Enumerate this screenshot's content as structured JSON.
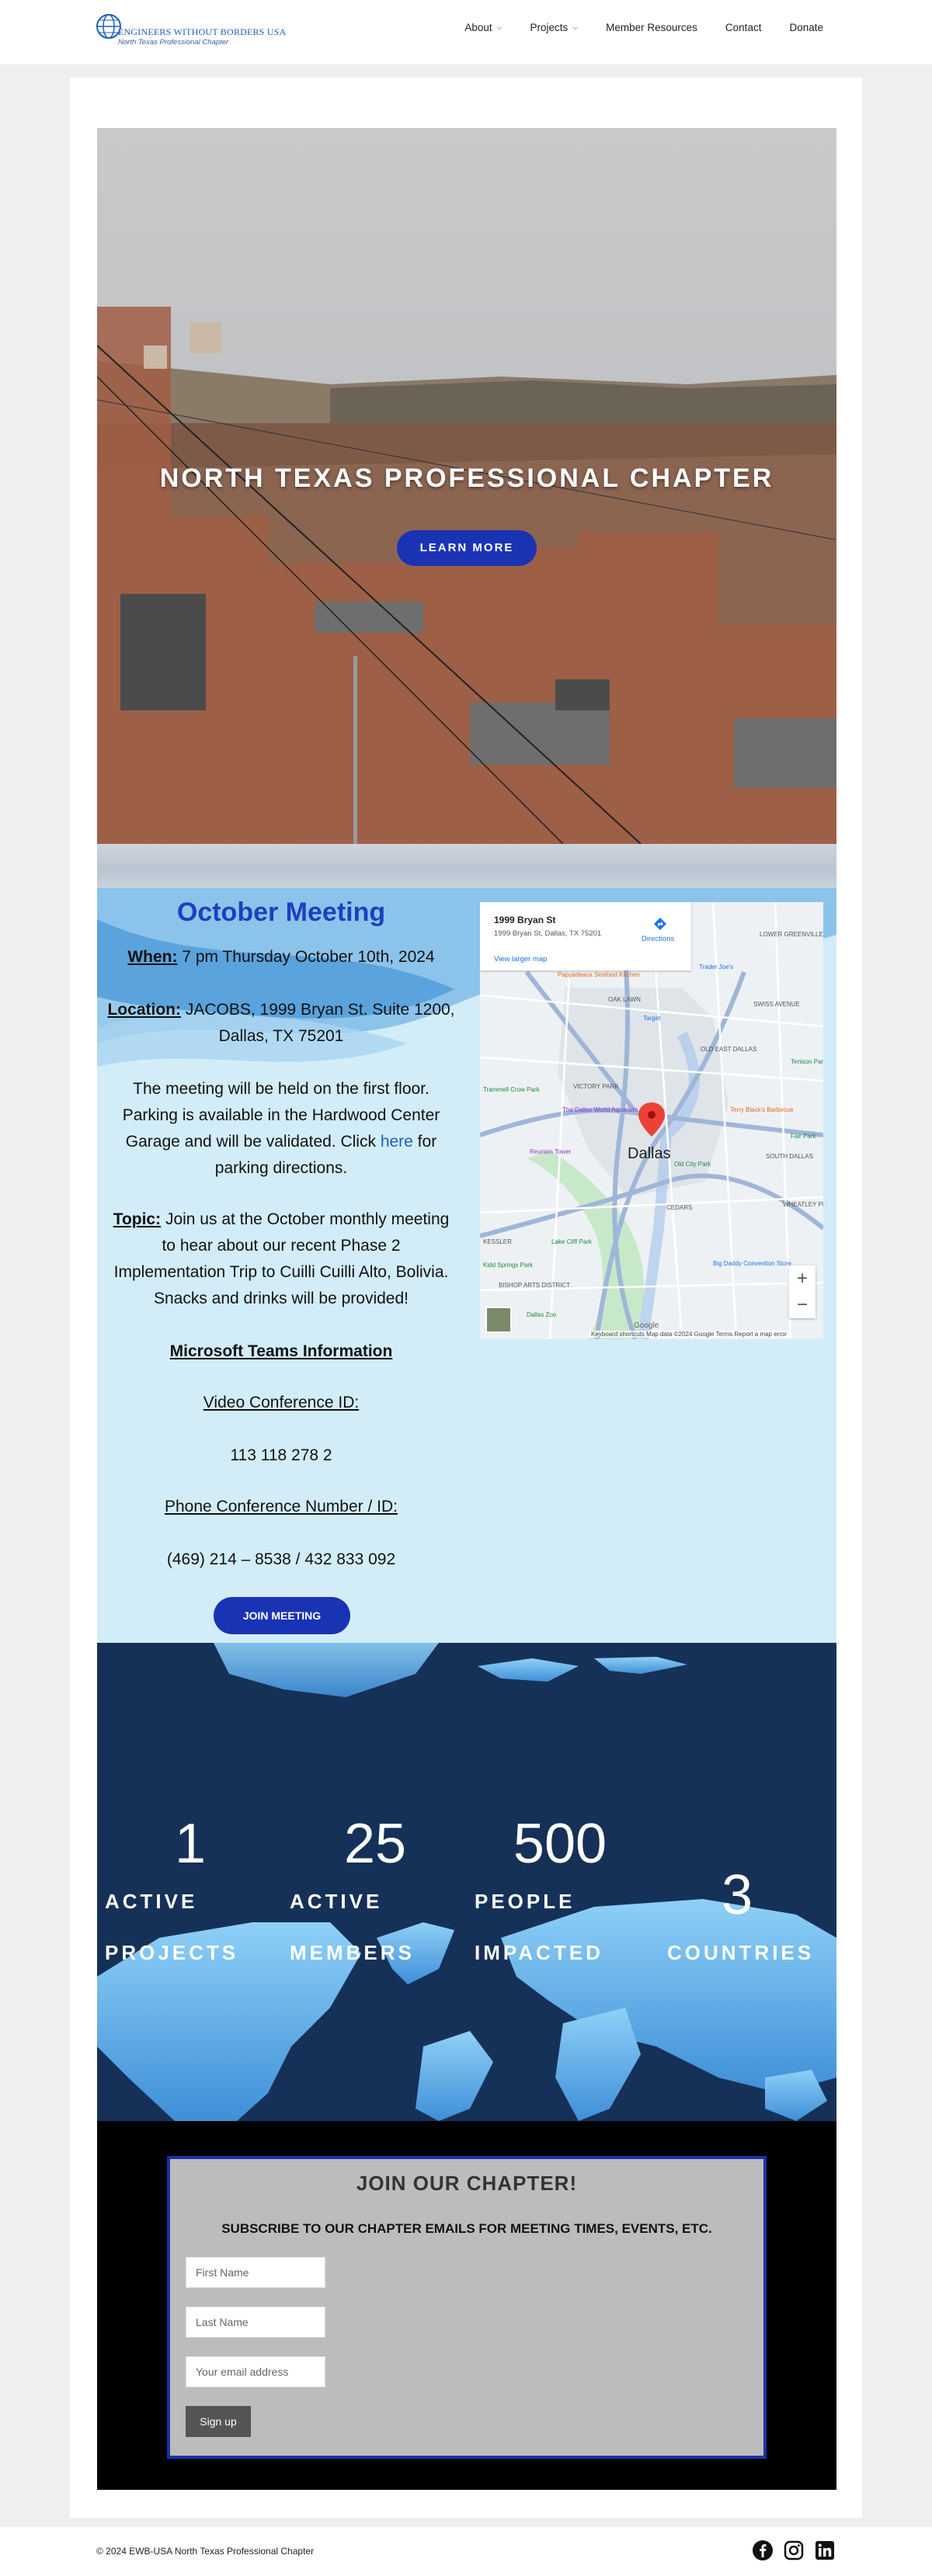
{
  "header": {
    "logo_title": "ENGINEERS WITHOUT BORDERS USA",
    "logo_subtitle": "North Texas Professional Chapter",
    "nav": [
      {
        "label": "About",
        "dropdown": true
      },
      {
        "label": "Projects",
        "dropdown": true
      },
      {
        "label": "Member Resources",
        "dropdown": false
      },
      {
        "label": "Contact",
        "dropdown": false
      },
      {
        "label": "Donate",
        "dropdown": false
      }
    ]
  },
  "hero": {
    "title": "NORTH TEXAS PROFESSIONAL CHAPTER",
    "button_label": "LEARN MORE"
  },
  "meeting": {
    "title": "October Meeting",
    "when_label": "When:",
    "when_text": " 7 pm Thursday October 10th, 2024",
    "location_label": "Location:",
    "location_text": " JACOBS, 1999 Bryan St. Suite 1200, Dallas, TX 75201",
    "parking_text_before": "The meeting will be held on the first floor. Parking is available in the Hardwood Center Garage and will be validated. Click ",
    "parking_link": "here",
    "parking_text_after": " for parking directions.",
    "topic_label": "Topic:",
    "topic_text": " Join us at the October monthly meeting to hear about our recent Phase 2 Implementation Trip to Cuilli Cuilli Alto, Bolivia. Snacks and drinks will be provided!",
    "teams_heading": "Microsoft Teams Information",
    "video_label": "Video Conference ID:",
    "video_id": "113 118 278 2",
    "phone_label": "Phone Conference Number / ID:",
    "phone_value": "(469) 214 – 8538 / 432 833 092",
    "join_button": "JOIN MEETING"
  },
  "map": {
    "place_name": "1999 Bryan St",
    "place_address": "1999 Bryan St, Dallas, TX 75201",
    "directions": "Directions",
    "larger_map": "View larger map",
    "city_label": "Dallas",
    "zoom_in": "+",
    "zoom_out": "−",
    "footer": "Keyboard shortcuts   Map data ©2024 Google   Terms   Report a map error",
    "labels": [
      "LOWER GREENVILLE",
      "OAK LAWN",
      "SWISS AVENUE",
      "OLD EAST DALLAS",
      "VICTORY PARK",
      "SOUTH DALLAS",
      "CEDARS",
      "Trader Joe's",
      "Target",
      "Pappadeaux Seafood Kitchen",
      "The Dallas World Aquarium",
      "Reunion Tower",
      "Terry Black's Barbecue",
      "Old City Park",
      "Big Daddy Convention Store",
      "Fair Park",
      "Dallas Zoo",
      "Kidd Springs Park",
      "Lake Cliff Park",
      "Trammell Crow Park",
      "KESSLER",
      "BISHOP ARTS DISTRICT",
      "WHEATLEY PLACE",
      "Tenison Par",
      "Google"
    ]
  },
  "stats": [
    {
      "value": "1",
      "label_line1": "ACTIVE",
      "label_line2": "PROJECTS"
    },
    {
      "value": "25",
      "label_line1": "ACTIVE",
      "label_line2": "MEMBERS"
    },
    {
      "value": "500",
      "label_line1": "PEOPLE",
      "label_line2": "IMPACTED"
    },
    {
      "value": "3",
      "label_line1": "COUNTRIES",
      "label_line2": ""
    }
  ],
  "subscribe": {
    "title": "JOIN OUR CHAPTER!",
    "text": "SUBSCRIBE TO OUR CHAPTER EMAILS FOR MEETING TIMES, EVENTS, ETC.",
    "first_name_placeholder": "First Name",
    "last_name_placeholder": "Last Name",
    "email_placeholder": "Your email address",
    "button": "Sign up"
  },
  "footer": {
    "copyright": "© 2024 EWB-USA North Texas Professional Chapter",
    "social_icons": [
      "facebook-icon",
      "instagram-icon",
      "linkedin-icon"
    ]
  },
  "colors": {
    "accent_blue": "#1a33b5",
    "meeting_title": "#1e3fbf",
    "meeting_bg": "#d2edf8",
    "stats_bg": "#163158",
    "subscribe_border": "#1b31a6"
  }
}
